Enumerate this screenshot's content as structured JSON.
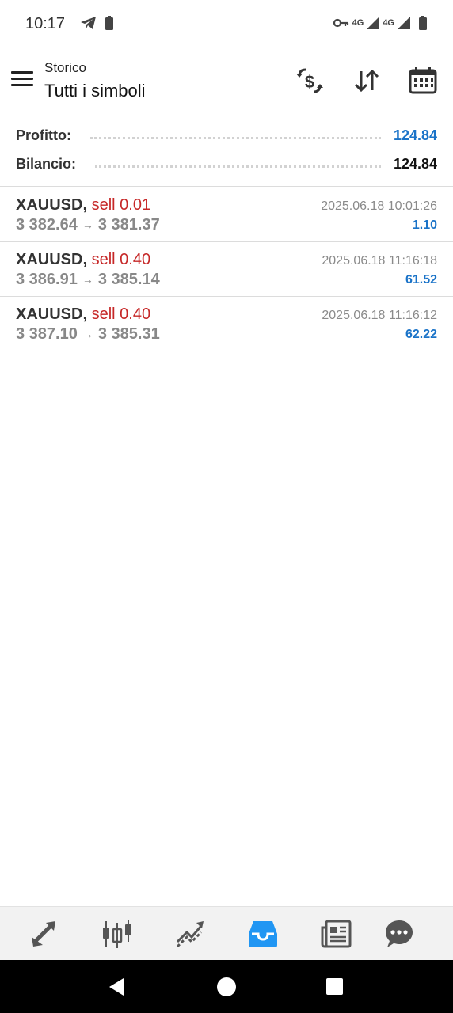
{
  "status_bar": {
    "time": "10:17",
    "net1": "4G",
    "net2": "4G"
  },
  "header": {
    "subtitle": "Storico",
    "title": "Tutti i simboli",
    "icons": [
      "menu-icon",
      "currency-exchange-icon",
      "sort-icon",
      "calendar-icon"
    ]
  },
  "summary": {
    "profit_label": "Profitto:",
    "profit_value": "124.84",
    "balance_label": "Bilancio:",
    "balance_value": "124.84",
    "profit_color": "#1a73c8"
  },
  "trades": [
    {
      "symbol": "XAUUSD,",
      "side": "sell 0.01",
      "open": "3 382.64",
      "close": "3 381.37",
      "date": "2025.06.18 10:01:26",
      "profit": "1.10"
    },
    {
      "symbol": "XAUUSD,",
      "side": "sell 0.40",
      "open": "3 386.91",
      "close": "3 385.14",
      "date": "2025.06.18 11:16:18",
      "profit": "61.52"
    },
    {
      "symbol": "XAUUSD,",
      "side": "sell 0.40",
      "open": "3 387.10",
      "close": "3 385.31",
      "date": "2025.06.18 11:16:12",
      "profit": "62.22"
    }
  ],
  "arrow": "→",
  "bottom_nav": {
    "items": [
      "quotes-icon",
      "chart-icon",
      "trade-icon",
      "history-icon",
      "news-icon",
      "chat-icon"
    ],
    "active": "history-icon",
    "active_color": "#2196f3"
  }
}
